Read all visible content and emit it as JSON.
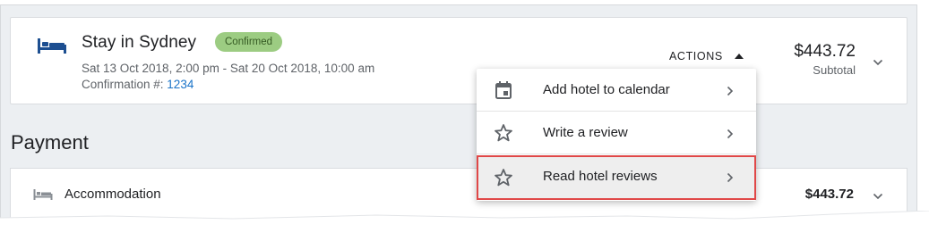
{
  "trip": {
    "title": "Stay in Sydney",
    "status": "Confirmed",
    "dates": "Sat 13 Oct 2018, 2:00 pm - Sat 20 Oct 2018, 10:00 am",
    "confirmation_label": "Confirmation #: ",
    "confirmation_number": "1234",
    "actions_label": "ACTIONS",
    "price": "$443.72",
    "subtotal_label": "Subtotal",
    "icon": "hotel-bed-icon"
  },
  "actions_menu": {
    "items": [
      {
        "label": "Add hotel to calendar",
        "icon": "calendar-icon",
        "highlighted": false
      },
      {
        "label": "Write a review",
        "icon": "star-outline-icon",
        "highlighted": false
      },
      {
        "label": "Read hotel reviews",
        "icon": "star-outline-icon",
        "highlighted": true
      }
    ]
  },
  "payment": {
    "section_title": "Payment",
    "rows": [
      {
        "label": "Accommodation",
        "amount": "$443.72",
        "icon": "bed-icon"
      }
    ]
  },
  "colors": {
    "accent_blue": "#1a73c8",
    "badge_green": "#9ccc82",
    "highlight_red": "#e04848",
    "icon_blue": "#1d4f91"
  }
}
